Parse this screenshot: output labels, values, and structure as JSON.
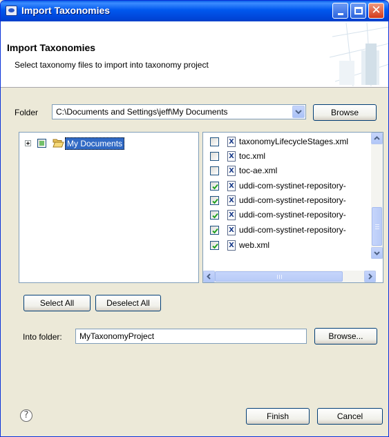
{
  "window": {
    "title": "Import Taxonomies",
    "minimize_icon": "minimize-icon",
    "maximize_icon": "maximize-icon",
    "close_icon": "close-icon"
  },
  "header": {
    "title": "Import Taxonomies",
    "description": "Select taxonomy files to import into taxonomy project"
  },
  "folder": {
    "label": "Folder",
    "value": "C:\\Documents and Settings\\jeff\\My Documents",
    "browse_label": "Browse"
  },
  "tree": {
    "root_label": "My Documents",
    "root_state": "partial"
  },
  "files": [
    {
      "name": "taxonomyLifecycleStages.xml",
      "checked": false
    },
    {
      "name": "toc.xml",
      "checked": false
    },
    {
      "name": "toc-ae.xml",
      "checked": false
    },
    {
      "name": "uddi-com-systinet-repository-",
      "checked": true
    },
    {
      "name": "uddi-com-systinet-repository-",
      "checked": true
    },
    {
      "name": "uddi-com-systinet-repository-",
      "checked": true
    },
    {
      "name": "uddi-com-systinet-repository-",
      "checked": true
    },
    {
      "name": "web.xml",
      "checked": true
    }
  ],
  "file_icon_glyph": "X",
  "selection": {
    "select_all_label": "Select All",
    "deselect_all_label": "Deselect All"
  },
  "into_folder": {
    "label": "Into folder:",
    "value": "MyTaxonomyProject",
    "browse_label": "Browse..."
  },
  "footer": {
    "help_glyph": "?",
    "finish_label": "Finish",
    "cancel_label": "Cancel"
  },
  "colors": {
    "titlebar": "#0058ee",
    "selection": "#316ac5",
    "check": "#21a121",
    "dialog_bg": "#ece9d8"
  }
}
